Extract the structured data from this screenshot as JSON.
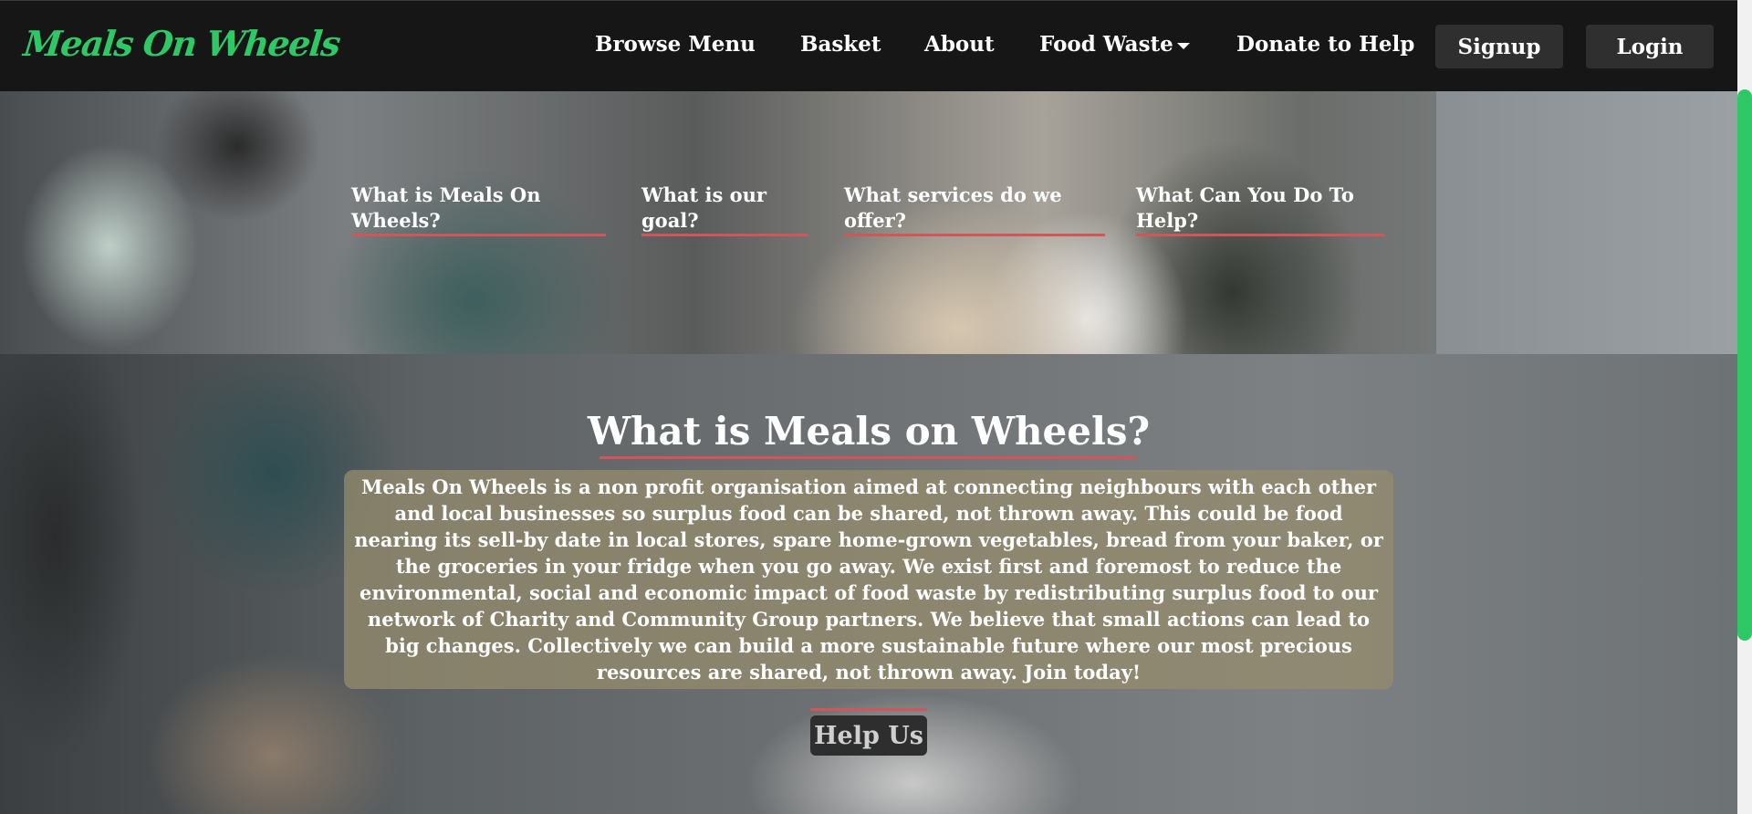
{
  "navbar": {
    "brand": "Meals On Wheels",
    "links": {
      "browse_menu": "Browse Menu",
      "basket": "Basket",
      "about": "About",
      "food_waste": "Food Waste",
      "donate": "Donate to Help"
    },
    "buttons": {
      "signup": "Signup",
      "login": "Login"
    },
    "accent_color": "#2fc866"
  },
  "hero": {
    "links": [
      {
        "label": "What is Meals On Wheels?"
      },
      {
        "label": "What is our goal?"
      },
      {
        "label": "What services do we offer?"
      },
      {
        "label": "What Can You Do To Help?"
      }
    ],
    "underline_color": "#d2555a"
  },
  "main": {
    "title": "What is Meals on Wheels?",
    "description": "Meals On Wheels is a non profit organisation aimed at connecting neighbours with each other and local businesses so surplus food can be shared, not thrown away. This could be food nearing its sell-by date in local stores, spare home-grown vegetables, bread from your baker, or the groceries in your fridge when you go away. We exist first and foremost to reduce the environmental, social and economic impact of food waste by redistributing surplus food to our network of Charity and Community Group partners. We believe that small actions can lead to big changes. Collectively we can build a more sustainable future where our most precious resources are shared, not thrown away. Join today!",
    "help_button": "Help Us"
  }
}
